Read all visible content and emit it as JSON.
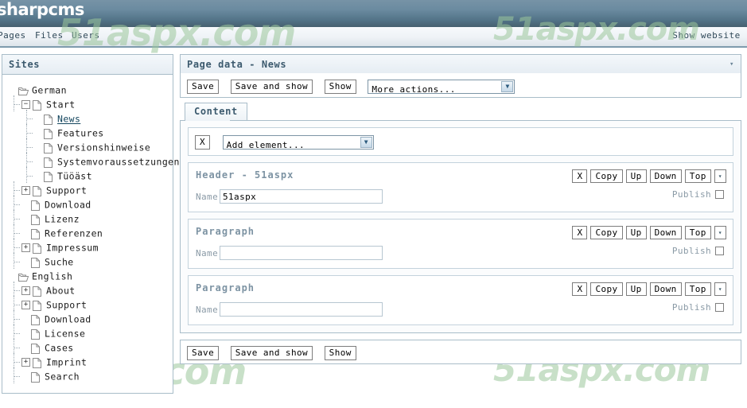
{
  "app": {
    "logo": "sharpcms",
    "colors": {
      "header_top": "#7793a6",
      "header_bottom": "#46606f",
      "panel_border": "#a9bdc9",
      "panel_title": "#3c5a6e",
      "element_title": "#7d93a3",
      "watermark": "#9cc79c"
    }
  },
  "menubar": {
    "items": [
      {
        "label": "Pages"
      },
      {
        "label": "Files"
      },
      {
        "label": "Users"
      }
    ],
    "right_nav": "Show website  L"
  },
  "sidebar": {
    "title": "Sites",
    "tree": [
      {
        "label": "German",
        "indent": 0,
        "toggle": "none",
        "icon": "folder-icon",
        "selected": false
      },
      {
        "label": "Start",
        "indent": 1,
        "toggle": "minus",
        "icon": "page-icon",
        "selected": false
      },
      {
        "label": "News",
        "indent": 2,
        "toggle": "none",
        "icon": "page-icon",
        "selected": true
      },
      {
        "label": "Features",
        "indent": 2,
        "toggle": "none",
        "icon": "page-icon",
        "selected": false
      },
      {
        "label": "Versionshinweise",
        "indent": 2,
        "toggle": "none",
        "icon": "page-icon",
        "selected": false
      },
      {
        "label": "Systemvoraussetzungen",
        "indent": 2,
        "toggle": "none",
        "icon": "page-icon",
        "selected": false
      },
      {
        "label": "Tüöäst",
        "indent": 2,
        "toggle": "none",
        "icon": "page-icon",
        "selected": false
      },
      {
        "label": "Support",
        "indent": 1,
        "toggle": "plus",
        "icon": "page-icon",
        "selected": false
      },
      {
        "label": "Download",
        "indent": 1,
        "toggle": "none",
        "icon": "page-icon",
        "selected": false
      },
      {
        "label": "Lizenz",
        "indent": 1,
        "toggle": "none",
        "icon": "page-icon",
        "selected": false
      },
      {
        "label": "Referenzen",
        "indent": 1,
        "toggle": "none",
        "icon": "page-icon",
        "selected": false
      },
      {
        "label": "Impressum",
        "indent": 1,
        "toggle": "plus",
        "icon": "page-icon",
        "selected": false
      },
      {
        "label": "Suche",
        "indent": 1,
        "toggle": "none",
        "icon": "page-icon",
        "selected": false
      },
      {
        "label": "English",
        "indent": 0,
        "toggle": "none",
        "icon": "folder-icon",
        "selected": false
      },
      {
        "label": "About",
        "indent": 1,
        "toggle": "plus",
        "icon": "page-icon",
        "selected": false
      },
      {
        "label": "Support",
        "indent": 1,
        "toggle": "plus",
        "icon": "page-icon",
        "selected": false
      },
      {
        "label": "Download",
        "indent": 1,
        "toggle": "none",
        "icon": "page-icon",
        "selected": false
      },
      {
        "label": "License",
        "indent": 1,
        "toggle": "none",
        "icon": "page-icon",
        "selected": false
      },
      {
        "label": "Cases",
        "indent": 1,
        "toggle": "none",
        "icon": "page-icon",
        "selected": false
      },
      {
        "label": "Imprint",
        "indent": 1,
        "toggle": "plus",
        "icon": "page-icon",
        "selected": false
      },
      {
        "label": "Search",
        "indent": 1,
        "toggle": "none",
        "icon": "page-icon",
        "selected": false
      }
    ]
  },
  "main": {
    "panel_title": "Page data - News",
    "toolbar_top": {
      "save_label": "Save",
      "save_and_show_label": "Save and show",
      "show_label": "Show",
      "more_actions_value": "More actions..."
    },
    "tabs": [
      {
        "label": "Content",
        "active": true
      }
    ],
    "add_element": {
      "remove_label": "X",
      "select_value": "Add element..."
    },
    "elements": [
      {
        "title": "Header - 51aspx",
        "name_label": "Name",
        "name_value": "51aspx",
        "publish_label": "Publish",
        "publish_checked": false,
        "buttons": [
          "X",
          "Copy",
          "Up",
          "Down",
          "Top"
        ],
        "caret": "▾"
      },
      {
        "title": "Paragraph",
        "name_label": "Name",
        "name_value": "",
        "publish_label": "Publish",
        "publish_checked": false,
        "buttons": [
          "X",
          "Copy",
          "Up",
          "Down",
          "Top"
        ],
        "caret": "▾"
      },
      {
        "title": "Paragraph",
        "name_label": "Name",
        "name_value": "",
        "publish_label": "Publish",
        "publish_checked": false,
        "buttons": [
          "X",
          "Copy",
          "Up",
          "Down",
          "Top"
        ],
        "caret": "▾"
      }
    ],
    "toolbar_bottom": {
      "save_label": "Save",
      "save_and_show_label": "Save and show",
      "show_label": "Show"
    },
    "panel_caret": "▾"
  },
  "watermarks": [
    {
      "text": "51aspx.com"
    },
    {
      "text": "51aspx.com"
    },
    {
      "text": "51aspx.com"
    },
    {
      "text": "51aspx.com"
    },
    {
      "text": "51aspx.com"
    }
  ]
}
